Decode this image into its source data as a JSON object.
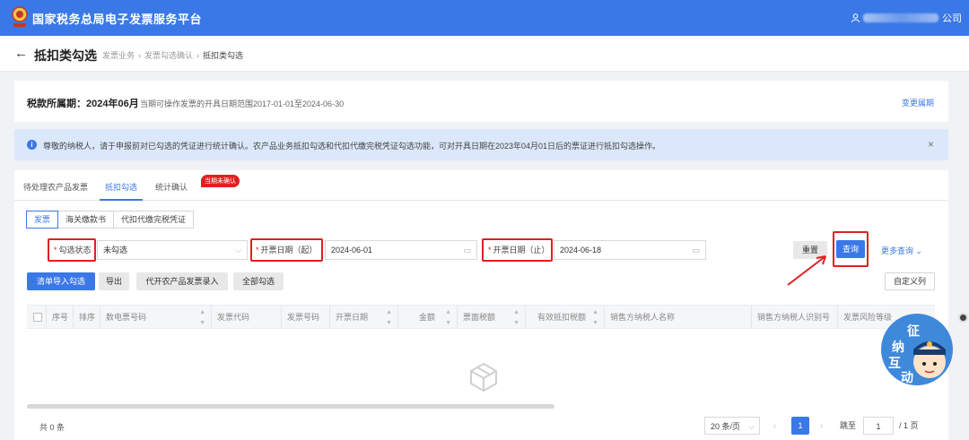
{
  "app": {
    "title": "国家税务总局电子发票服务平台",
    "user_suffix": "公司"
  },
  "header": {
    "back_glyph": "←",
    "page_title": "抵扣类勾选",
    "breadcrumbs": [
      "发票业务",
      "发票勾选确认",
      "抵扣类勾选"
    ]
  },
  "period": {
    "label": "税款所属期：2024年06月",
    "range_text": "当期可操作发票的开具日期范围2017-01-01至2024-06-30",
    "change_link": "变更属期"
  },
  "notice": {
    "text": "尊敬的纳税人，请于申报前对已勾选的凭证进行统计确认。农产品业务抵扣勾选和代扣代缴完税凭证勾选功能，可对开具日期在2023年04月01日后的票证进行抵扣勾选操作。",
    "close": "×"
  },
  "tabs": {
    "items": [
      "待处理农产品发票",
      "抵扣勾选",
      "统计确认"
    ],
    "active_index": 1,
    "badge": "当期未确认"
  },
  "subtabs": {
    "items": [
      "发票",
      "海关缴款书",
      "代扣代缴完税凭证"
    ],
    "active_index": 0
  },
  "filters": {
    "status_label": "勾选状态",
    "status_value": "未勾选",
    "start_label": "开票日期（起）",
    "start_value": "2024-06-01",
    "end_label": "开票日期（止）",
    "end_value": "2024-06-18",
    "required_mark": "*"
  },
  "buttons": {
    "reset": "重置",
    "query": "查询",
    "more_query": "更多查询",
    "import": "清单导入勾选",
    "export": "导出",
    "agri_entry": "代开农产品发票录入",
    "select_all": "全部勾选",
    "custom_columns": "自定义列"
  },
  "table": {
    "columns": [
      "序号",
      "排序",
      "数电票号码",
      "发票代码",
      "发票号码",
      "开票日期",
      "金额",
      "票面税额",
      "有效抵扣税额",
      "销售方纳税人名称",
      "销售方纳税人识别号",
      "发票风险等级"
    ],
    "rows": []
  },
  "pagination": {
    "total": "共 0 条",
    "page_size": "20 条/页",
    "current_page": "1",
    "goto_label": "跳至",
    "goto_value": "1",
    "total_pages": "/ 1 页"
  },
  "mascot": {
    "chars": [
      "征",
      "纳",
      "互",
      "动"
    ]
  },
  "colors": {
    "primary": "#3b78e7",
    "highlight": "#e02020",
    "notice_bg": "#dbe8fb"
  }
}
